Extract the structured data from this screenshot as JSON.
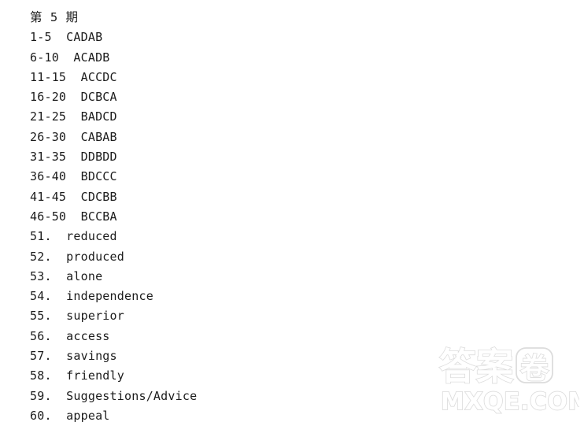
{
  "document": {
    "title_line": "第 5 期",
    "lines": [
      "第 5 期",
      "1-5  CADAB",
      "6-10  ACADB",
      "11-15  ACCDC",
      "16-20  DCBCA",
      "21-25  BADCD",
      "26-30  CABAB",
      "31-35  DDBDD",
      "36-40  BDCCC",
      "41-45  CDCBB",
      "46-50  BCCBA",
      "51.  reduced",
      "52.  produced",
      "53.  alone",
      "54.  independence",
      "55.  superior",
      "56.  access",
      "57.  savings",
      "58.  friendly",
      "59.  Suggestions/Advice",
      "60.  appeal"
    ],
    "multiple_choice": [
      {
        "range": "1-5",
        "answers": "CADAB"
      },
      {
        "range": "6-10",
        "answers": "ACADB"
      },
      {
        "range": "11-15",
        "answers": "ACCDC"
      },
      {
        "range": "16-20",
        "answers": "DCBCA"
      },
      {
        "range": "21-25",
        "answers": "BADCD"
      },
      {
        "range": "26-30",
        "answers": "CABAB"
      },
      {
        "range": "31-35",
        "answers": "DDBDD"
      },
      {
        "range": "36-40",
        "answers": "BDCCC"
      },
      {
        "range": "41-45",
        "answers": "CDCBB"
      },
      {
        "range": "46-50",
        "answers": "BCCBA"
      }
    ],
    "word_answers": [
      {
        "number": "51.",
        "word": "reduced"
      },
      {
        "number": "52.",
        "word": "produced"
      },
      {
        "number": "53.",
        "word": "alone"
      },
      {
        "number": "54.",
        "word": "independence"
      },
      {
        "number": "55.",
        "word": "superior"
      },
      {
        "number": "56.",
        "word": "access"
      },
      {
        "number": "57.",
        "word": "savings"
      },
      {
        "number": "58.",
        "word": "friendly"
      },
      {
        "number": "59.",
        "word": "Suggestions/Advice"
      },
      {
        "number": "60.",
        "word": "appeal"
      }
    ],
    "text_color": "#1b1b1b",
    "background_color": "#ffffff"
  },
  "watermark": {
    "cjk_text": "答案",
    "cjk_boxed_char": "卷",
    "latin_text": "MXQE.COM",
    "outline_color": "#dcdcdc",
    "fill_color": "#ffffff"
  }
}
